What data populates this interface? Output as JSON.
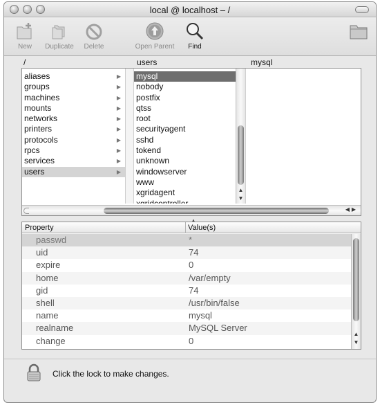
{
  "window": {
    "title": "local @ localhost – /"
  },
  "toolbar": {
    "new_label": "New",
    "duplicate_label": "Duplicate",
    "delete_label": "Delete",
    "open_parent_label": "Open Parent",
    "find_label": "Find"
  },
  "browser": {
    "col_headers": [
      "/",
      "users",
      "mysql"
    ],
    "col1": [
      "aliases",
      "groups",
      "machines",
      "mounts",
      "networks",
      "printers",
      "protocols",
      "rpcs",
      "services",
      "users"
    ],
    "col1_selected": "users",
    "col2": [
      "mysql",
      "nobody",
      "postfix",
      "qtss",
      "root",
      "securityagent",
      "sshd",
      "tokend",
      "unknown",
      "windowserver",
      "www",
      "xgridagent",
      "xgridcontroller"
    ],
    "col2_selected": "mysql"
  },
  "properties": {
    "header_property": "Property",
    "header_values": "Value(s)",
    "rows": [
      {
        "key": "passwd",
        "value": "*"
      },
      {
        "key": "uid",
        "value": "74"
      },
      {
        "key": "expire",
        "value": "0"
      },
      {
        "key": "home",
        "value": "/var/empty"
      },
      {
        "key": "gid",
        "value": "74"
      },
      {
        "key": "shell",
        "value": "/usr/bin/false"
      },
      {
        "key": "name",
        "value": "mysql"
      },
      {
        "key": "realname",
        "value": "MySQL Server"
      },
      {
        "key": "change",
        "value": "0"
      }
    ]
  },
  "footer": {
    "lock_message": "Click the lock to make changes."
  }
}
